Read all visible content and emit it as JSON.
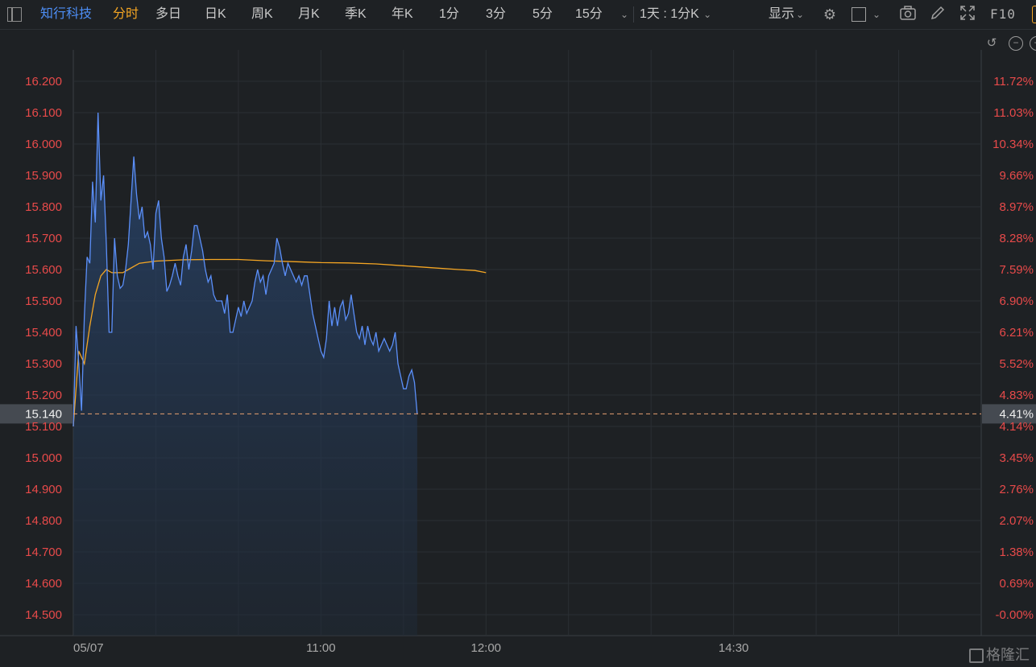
{
  "toolbar": {
    "stock_name": "知行科技",
    "tabs": [
      "分时",
      "多日",
      "日K",
      "周K",
      "月K",
      "季K",
      "年K",
      "1分",
      "3分",
      "5分",
      "15分"
    ],
    "active_tab": "分时",
    "period_select": "1天 : 1分K",
    "display_label": "显示",
    "f10_label": "F10"
  },
  "colors": {
    "price_line": "#5b8ff9",
    "avg_line": "#f5a623",
    "axis_text": "#e84a4a",
    "grid": "#2b2f34",
    "background": "#1e2124",
    "current_marker": "#e8a070"
  },
  "watermark": {
    "text": "格隆汇"
  },
  "chart_data": {
    "type": "line",
    "prev_close": 14.5,
    "current_price": 15.14,
    "current_price_label": "15.140",
    "current_pct_label": "4.41%",
    "ylim": [
      14.5,
      16.2
    ],
    "y_ticks": [
      "16.200",
      "16.100",
      "16.000",
      "15.900",
      "15.800",
      "15.700",
      "15.600",
      "15.500",
      "15.400",
      "15.300",
      "15.200",
      "15.100",
      "15.000",
      "14.900",
      "14.800",
      "14.700",
      "14.600",
      "14.500"
    ],
    "pct_ticks": [
      "11.72%",
      "11.03%",
      "10.34%",
      "9.66%",
      "8.97%",
      "8.28%",
      "7.59%",
      "6.90%",
      "6.21%",
      "5.52%",
      "4.83%",
      "4.14%",
      "3.45%",
      "2.76%",
      "2.07%",
      "1.38%",
      "0.69%",
      "-0.00%"
    ],
    "x_labels": [
      {
        "label": "05/07",
        "minute": 0
      },
      {
        "label": "11:00",
        "minute": 90
      },
      {
        "label": "12:00",
        "minute": 150
      },
      {
        "label": "14:30",
        "minute": 240
      }
    ],
    "total_minutes": 330,
    "series": [
      {
        "name": "price",
        "minutes": [
          0,
          1,
          2,
          3,
          4,
          5,
          6,
          7,
          8,
          9,
          10,
          11,
          12,
          13,
          14,
          15,
          16,
          17,
          18,
          19,
          20,
          21,
          22,
          23,
          24,
          25,
          26,
          27,
          28,
          29,
          30,
          31,
          32,
          33,
          34,
          35,
          36,
          37,
          38,
          39,
          40,
          41,
          42,
          43,
          44,
          45,
          46,
          47,
          48,
          49,
          50,
          51,
          52,
          53,
          54,
          55,
          56,
          57,
          58,
          59,
          60,
          61,
          62,
          63,
          64,
          65,
          66,
          67,
          68,
          69,
          70,
          71,
          72,
          73,
          74,
          75,
          76,
          77,
          78,
          79,
          80,
          81,
          82,
          83,
          84,
          85,
          86,
          87,
          88,
          89,
          90,
          91,
          92,
          93,
          94,
          95,
          96,
          97,
          98,
          99,
          100,
          101,
          102,
          103,
          104,
          105,
          106,
          107,
          108,
          109,
          110,
          111,
          112,
          113,
          114,
          115,
          116,
          117,
          118,
          119,
          120,
          121,
          122,
          123,
          124,
          125,
          126,
          127,
          128,
          129,
          130,
          131,
          132,
          133,
          134,
          135,
          136,
          137,
          138,
          139,
          140,
          141,
          142,
          143,
          144,
          145,
          146,
          147,
          148,
          149,
          150
        ],
        "values": [
          15.1,
          15.42,
          15.3,
          15.15,
          15.45,
          15.64,
          15.62,
          15.88,
          15.75,
          16.1,
          15.82,
          15.9,
          15.68,
          15.4,
          15.4,
          15.7,
          15.58,
          15.54,
          15.55,
          15.6,
          15.68,
          15.82,
          15.96,
          15.84,
          15.76,
          15.8,
          15.7,
          15.72,
          15.68,
          15.6,
          15.78,
          15.82,
          15.7,
          15.64,
          15.53,
          15.55,
          15.58,
          15.62,
          15.58,
          15.55,
          15.64,
          15.68,
          15.6,
          15.66,
          15.74,
          15.74,
          15.7,
          15.66,
          15.6,
          15.56,
          15.58,
          15.52,
          15.5,
          15.5,
          15.5,
          15.46,
          15.52,
          15.4,
          15.4,
          15.44,
          15.48,
          15.45,
          15.5,
          15.46,
          15.48,
          15.5,
          15.56,
          15.6,
          15.56,
          15.58,
          15.52,
          15.58,
          15.6,
          15.62,
          15.7,
          15.67,
          15.62,
          15.58,
          15.62,
          15.6,
          15.58,
          15.56,
          15.58,
          15.55,
          15.58,
          15.58,
          15.52,
          15.46,
          15.42,
          15.38,
          15.34,
          15.32,
          15.38,
          15.5,
          15.42,
          15.48,
          15.42,
          15.48,
          15.5,
          15.44,
          15.46,
          15.52,
          15.46,
          15.4,
          15.38,
          15.42,
          15.36,
          15.42,
          15.38,
          15.36,
          15.4,
          15.34,
          15.36,
          15.38,
          15.36,
          15.34,
          15.36,
          15.4,
          15.3,
          15.26,
          15.22,
          15.22,
          15.26,
          15.28,
          15.24,
          15.14,
          15.14,
          15.14,
          15.14,
          15.14,
          15.14,
          15.14,
          15.14,
          15.14,
          15.14,
          15.14,
          15.14,
          15.14,
          15.14,
          15.14,
          15.14,
          15.14,
          15.14,
          15.14,
          15.14,
          15.14,
          15.14,
          15.14,
          15.14
        ]
      },
      {
        "name": "avg",
        "minutes": [
          0,
          2,
          4,
          6,
          8,
          10,
          12,
          14,
          16,
          18,
          20,
          24,
          30,
          40,
          50,
          60,
          70,
          80,
          90,
          100,
          110,
          120,
          130,
          140,
          146,
          150
        ],
        "values": [
          15.1,
          15.34,
          15.3,
          15.42,
          15.52,
          15.58,
          15.6,
          15.59,
          15.59,
          15.59,
          15.6,
          15.62,
          15.627,
          15.631,
          15.632,
          15.632,
          15.628,
          15.625,
          15.622,
          15.621,
          15.618,
          15.612,
          15.606,
          15.6,
          15.597,
          15.59
        ]
      }
    ],
    "price_end_minute": 125
  }
}
